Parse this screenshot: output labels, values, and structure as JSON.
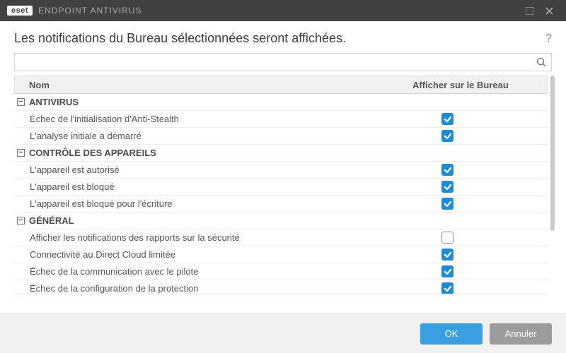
{
  "titlebar": {
    "brand": "eset",
    "product": "ENDPOINT ANTIVIRUS"
  },
  "heading": "Les notifications du Bureau sélectionnées seront affichées.",
  "columns": {
    "name": "Nom",
    "show": "Afficher sur le Bureau"
  },
  "search": {
    "value": ""
  },
  "groups": [
    {
      "label": "ANTIVIRUS",
      "items": [
        {
          "label": "Échec de l'initialisation d'Anti-Stealth",
          "checked": true
        },
        {
          "label": "L'analyse initiale a démarré",
          "checked": true
        }
      ]
    },
    {
      "label": "CONTRÔLE DES APPAREILS",
      "items": [
        {
          "label": "L'appareil est autorisé",
          "checked": true
        },
        {
          "label": "L'appareil est bloqué",
          "checked": true
        },
        {
          "label": "L'appareil est bloqué pour l'écriture",
          "checked": true
        }
      ]
    },
    {
      "label": "GÉNÉRAL",
      "items": [
        {
          "label": "Afficher les notifications des rapports sur la sécurité",
          "checked": false
        },
        {
          "label": "Connectivité au Direct Cloud limitée",
          "checked": true
        },
        {
          "label": "Échec de la communication avec le pilote",
          "checked": true
        },
        {
          "label": "Échec de la configuration de la protection",
          "checked": true
        }
      ]
    }
  ],
  "footer": {
    "ok": "OK",
    "cancel": "Annuler"
  }
}
